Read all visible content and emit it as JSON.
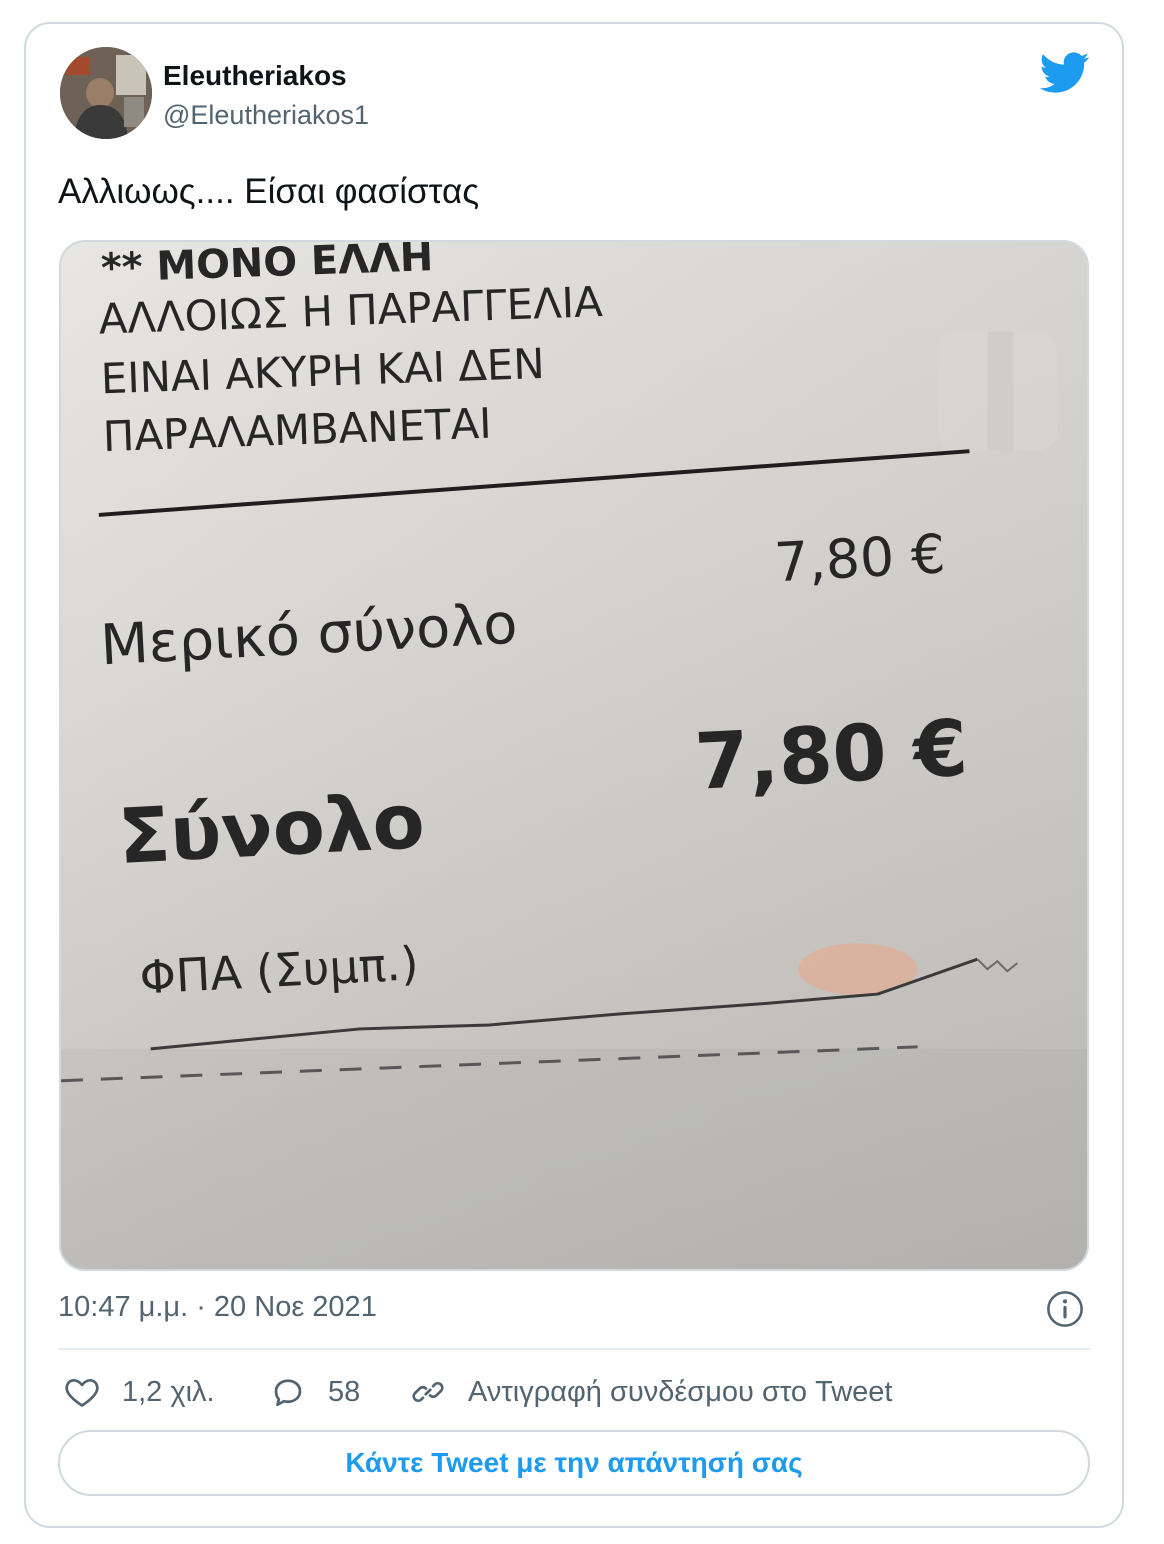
{
  "author": {
    "display_name": "Eleutheriakos",
    "handle": "@Eleutheriakos1",
    "avatar_icon": "avatar-photo"
  },
  "brand": {
    "icon": "twitter-bird-icon",
    "color": "#1d9bf0"
  },
  "tweet": {
    "text": "Αλλιωως.... Είσαι φασίστας"
  },
  "media": {
    "description_kind": "receipt-photo",
    "receipt_lines": {
      "cut_line": "** ΜΟΝΟ ΕΛΛΗ",
      "line1": "ΑΛΛΟΙΩΣ Η ΠΑΡΑΓΓΕΛΙΑ",
      "line2": "ΕΙΝΑΙ ΑΚΥΡΗ ΚΑΙ ΔΕΝ",
      "line3": "ΠΑΡΑΛΑΜΒΑΝΕΤΑΙ",
      "subtotal_label": "Μερικό σύνολο",
      "subtotal_value": "7,80 €",
      "total_label": "Σύνολο",
      "total_value": "7,80 €",
      "vat_label": "ΦΠΑ (Συμπ.)"
    }
  },
  "meta": {
    "timestamp": "10:47 μ.μ. · 20 Νοε 2021",
    "info_icon": "info-icon"
  },
  "actions": {
    "likes": "1,2 χιλ.",
    "replies": "58",
    "copy_link": "Αντιγραφή συνδέσμου στο Tweet"
  },
  "reply_button": "Κάντε Tweet με την απάντησή σας",
  "colors": {
    "border": "#cfd9de",
    "secondary_text": "#536471",
    "accent": "#1d9bf0"
  }
}
